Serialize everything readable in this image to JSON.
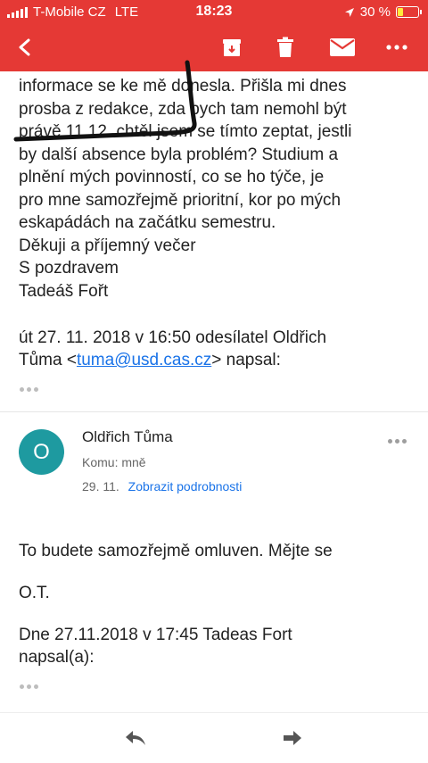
{
  "status_bar": {
    "carrier": "T-Mobile CZ",
    "network": "LTE",
    "time": "18:23",
    "battery": "30 %",
    "battery_level": 0.3
  },
  "app_bar": {
    "icons": [
      "back-arrow-icon",
      "archive-icon",
      "trash-icon",
      "mail-icon",
      "more-icon"
    ],
    "color": "#e53935"
  },
  "message1": {
    "lines": [
      "informace se ke mě donesla. Přišla mi dnes",
      "prosba z redakce, zda bych tam nemohl být",
      "právě 11.12. chtěl jsem se tímto zeptat, jestli",
      "by další absence byla problém? Studium a",
      "plnění mých povinností, co se ho týče, je",
      "pro mne samozřejmě prioritní, kor po mých",
      "eskapádách na začátku semestru.",
      "Děkuji a příjemný večer",
      "S pozdravem",
      "Tadeáš Fořt"
    ],
    "quote_line1": "út 27. 11. 2018 v 16:50 odesílatel Oldřich",
    "quote_name": "Tůma <",
    "quote_email": "tuma@usd.cas.cz",
    "quote_tail": "> napsal:"
  },
  "message2": {
    "avatar_letter": "O",
    "avatar_color": "#1e9aa0",
    "sender": "Oldřich Tůma",
    "recipient": "Komu: mně",
    "date": "29. 11.",
    "details_link": "Zobrazit podrobnosti",
    "body": [
      "To budete samozřejmě omluven. Mějte se",
      "O.T.",
      "Dne 27.11.2018 v 17:45 Tadeas Fort",
      "napsal(a):"
    ]
  },
  "bottom_bar": {
    "icons": [
      "reply-icon",
      "forward-icon"
    ]
  }
}
